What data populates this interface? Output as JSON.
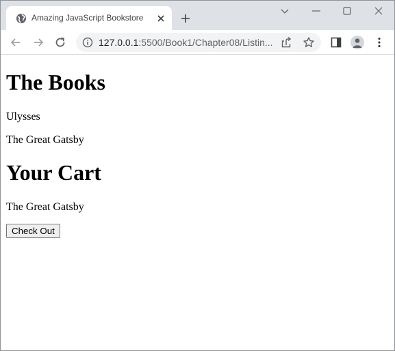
{
  "browser": {
    "tab": {
      "title": "Amazing JavaScript Bookstore",
      "favicon": "globe-icon"
    },
    "address_bar": {
      "host": "127.0.0.1",
      "rest": ":5500/Book1/Chapter08/Listin..."
    }
  },
  "page": {
    "books_heading": "The Books",
    "books": [
      "Ulysses",
      "The Great Gatsby"
    ],
    "cart_heading": "Your Cart",
    "cart": [
      "The Great Gatsby"
    ],
    "checkout_label": "Check Out"
  },
  "colors": {
    "tabstrip_bg": "#dee1e6",
    "omnibox_bg": "#f1f3f4",
    "icon_gray": "#5f6368"
  }
}
